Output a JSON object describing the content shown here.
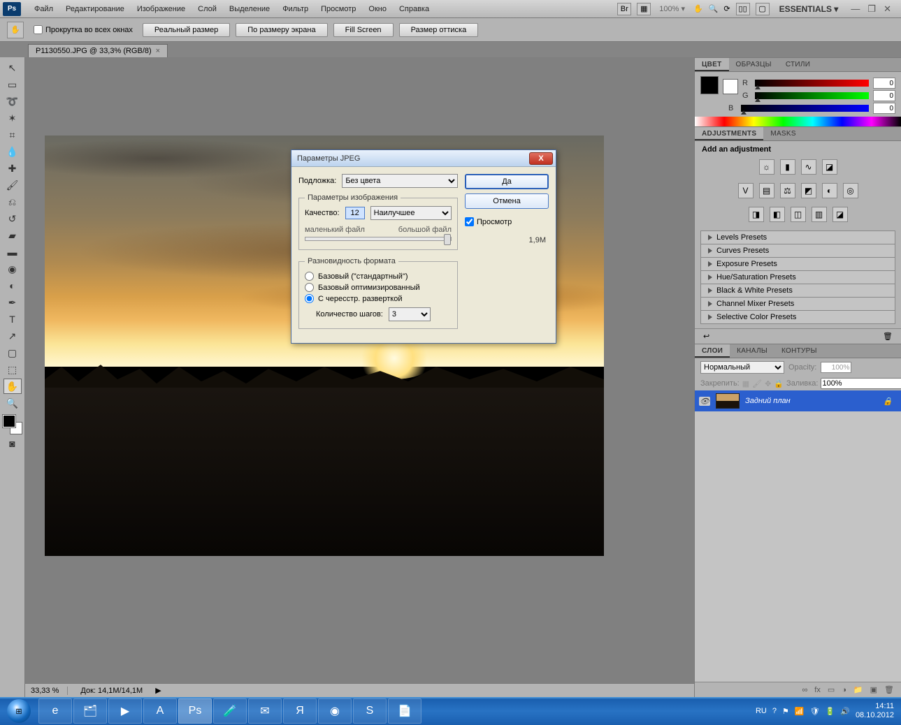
{
  "menubar": {
    "items": [
      "Файл",
      "Редактирование",
      "Изображение",
      "Слой",
      "Выделение",
      "Фильтр",
      "Просмотр",
      "Окно",
      "Справка"
    ],
    "zoom": "100% ▾",
    "workspace": "ESSENTIALS ▾"
  },
  "options": {
    "scroll_all": "Прокрутка во всех окнах",
    "buttons": [
      "Реальный размер",
      "По размеру экрана",
      "Fill Screen",
      "Размер оттиска"
    ]
  },
  "doc_tab": "P1130550.JPG @ 33,3% (RGB/8)",
  "status": {
    "zoom": "33,33 %",
    "doc": "Док:  14,1M/14,1M"
  },
  "color_panel": {
    "tabs": [
      "ЦВЕТ",
      "ОБРАЗЦЫ",
      "СТИЛИ"
    ],
    "r_label": "R",
    "g_label": "G",
    "b_label": "B",
    "r": "0",
    "g": "0",
    "b": "0"
  },
  "adjustments": {
    "tabs": [
      "ADJUSTMENTS",
      "MASKS"
    ],
    "heading": "Add an adjustment",
    "presets": [
      "Levels Presets",
      "Curves Presets",
      "Exposure Presets",
      "Hue/Saturation Presets",
      "Black & White Presets",
      "Channel Mixer Presets",
      "Selective Color Presets"
    ]
  },
  "layers": {
    "tabs": [
      "СЛОИ",
      "КАНАЛЫ",
      "КОНТУРЫ"
    ],
    "mode": "Нормальный",
    "opacity_label": "Opacity:",
    "opacity": "100%",
    "lock_label": "Закрепить:",
    "fill_label": "Заливка:",
    "fill": "100%",
    "layer_name": "Задний план"
  },
  "dialog": {
    "title": "Параметры JPEG",
    "matte_label": "Подложка:",
    "matte_value": "Без цвета",
    "img_legend": "Параметры изображения",
    "quality_label": "Качество:",
    "quality": "12",
    "quality_preset": "Наилучшее",
    "small_label": "маленький файл",
    "big_label": "большой файл",
    "fmt_legend": "Разновидность формата",
    "fmt1": "Базовый (\"стандартный\")",
    "fmt2": "Базовый оптимизированный",
    "fmt3": "С чересстр. разверткой",
    "scans_label": "Количество шагов:",
    "scans": "3",
    "ok": "Да",
    "cancel": "Отмена",
    "preview": "Просмотр",
    "filesize": "1,9M"
  },
  "taskbar": {
    "lang": "RU",
    "time": "14:11",
    "date": "08.10.2012"
  }
}
